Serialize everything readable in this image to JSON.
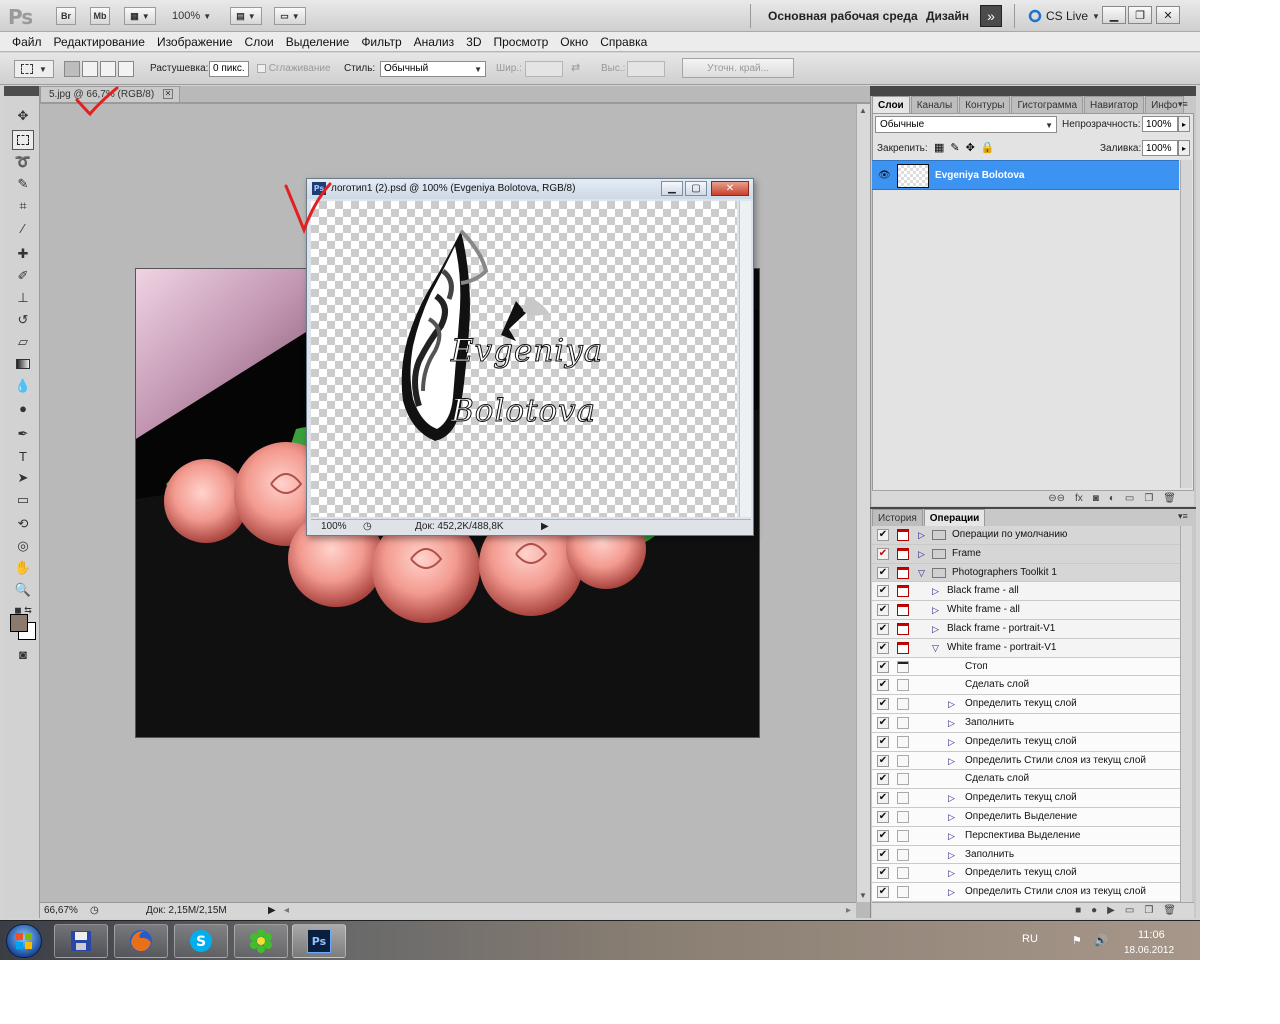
{
  "app": {
    "zoom": "100%",
    "workspace": "Основная рабочая среда",
    "workspace_alt": "Дизайн",
    "cs_live": "CS Live",
    "br_label": "Br",
    "mb_label": "Mb"
  },
  "menu": [
    "Файл",
    "Редактирование",
    "Изображение",
    "Слои",
    "Выделение",
    "Фильтр",
    "Анализ",
    "3D",
    "Просмотр",
    "Окно",
    "Справка"
  ],
  "options": {
    "feather_label": "Растушевка:",
    "feather_value": "0 пикс.",
    "antialias_label": "Сглаживание",
    "style_label": "Стиль:",
    "style_value": "Обычный",
    "width_label": "Шир.:",
    "height_label": "Выс.:",
    "refine_label": "Уточн. край..."
  },
  "document": {
    "tab_label": "5.jpg @ 66,7% (RGB/8)",
    "zoom": "66,67%",
    "doc_info": "Док: 2,15M/2,15M"
  },
  "float_window": {
    "title": "логотип1 (2).psd @ 100% (Evgeniya Bolotova, RGB/8)",
    "logo_line1": "Evgeniya",
    "logo_line2": "Bolotova",
    "zoom": "100%",
    "doc_info": "Док: 452,2K/488,8K"
  },
  "layers_panel": {
    "tabs": [
      "Слои",
      "Каналы",
      "Контуры",
      "Гистограмма",
      "Навигатор",
      "Инфо"
    ],
    "blend_mode": "Обычные",
    "opacity_label": "Непрозрачность:",
    "opacity_value": "100%",
    "lock_label": "Закрепить:",
    "fill_label": "Заливка:",
    "fill_value": "100%",
    "layer_name": "Evgeniya Bolotova"
  },
  "actions_panel": {
    "tabs": [
      "История",
      "Операции"
    ],
    "rows": [
      {
        "text": "Операции по умолчанию",
        "kind": "set",
        "check": "✔",
        "dialog": "red",
        "expanded": false
      },
      {
        "text": "Frame",
        "kind": "set",
        "check": "✔",
        "dialog": "red",
        "expanded": false
      },
      {
        "text": "Photographers Toolkit 1",
        "kind": "set",
        "check": "✔",
        "dialog": "red",
        "expanded": true
      },
      {
        "text": "Black frame - all",
        "kind": "action",
        "check": "✔",
        "dialog": "red",
        "expanded": false
      },
      {
        "text": "White frame - all",
        "kind": "action",
        "check": "✔",
        "dialog": "red",
        "expanded": false
      },
      {
        "text": "Black frame - portrait-V1",
        "kind": "action",
        "check": "✔",
        "dialog": "red",
        "expanded": false
      },
      {
        "text": "White frame - portrait-V1",
        "kind": "action",
        "check": "✔",
        "dialog": "red",
        "expanded": true
      },
      {
        "text": "Стоп",
        "kind": "cmd",
        "check": "✔",
        "dialog": "blk",
        "expanded": null
      },
      {
        "text": "Сделать слой",
        "kind": "cmd",
        "check": "✔",
        "dialog": "",
        "expanded": null
      },
      {
        "text": "Определить текущ слой",
        "kind": "cmd",
        "check": "✔",
        "dialog": "",
        "expanded": false
      },
      {
        "text": "Заполнить",
        "kind": "cmd",
        "check": "✔",
        "dialog": "",
        "expanded": false
      },
      {
        "text": "Определить текущ слой",
        "kind": "cmd",
        "check": "✔",
        "dialog": "",
        "expanded": false
      },
      {
        "text": "Определить Стили слоя из текущ слой",
        "kind": "cmd",
        "check": "✔",
        "dialog": "",
        "expanded": false
      },
      {
        "text": "Сделать слой",
        "kind": "cmd",
        "check": "✔",
        "dialog": "",
        "expanded": null
      },
      {
        "text": "Определить текущ слой",
        "kind": "cmd",
        "check": "✔",
        "dialog": "",
        "expanded": false
      },
      {
        "text": "Определить Выделение",
        "kind": "cmd",
        "check": "✔",
        "dialog": "",
        "expanded": false
      },
      {
        "text": "Перспектива Выделение",
        "kind": "cmd",
        "check": "✔",
        "dialog": "",
        "expanded": false
      },
      {
        "text": "Заполнить",
        "kind": "cmd",
        "check": "✔",
        "dialog": "",
        "expanded": false
      },
      {
        "text": "Определить текущ слой",
        "kind": "cmd",
        "check": "✔",
        "dialog": "",
        "expanded": false
      },
      {
        "text": "Определить Стили слоя из текущ слой",
        "kind": "cmd",
        "check": "✔",
        "dialog": "",
        "expanded": false
      }
    ]
  },
  "taskbar": {
    "lang": "RU",
    "time": "11:06",
    "date": "18.06.2012",
    "apps": [
      "save-app",
      "firefox",
      "skype",
      "icq",
      "photoshop"
    ],
    "ps_label": "Ps"
  },
  "colors": {
    "selected_layer": "#3d93f2",
    "foreground": "#8c7a6e",
    "annotation_red": "#e32020"
  }
}
